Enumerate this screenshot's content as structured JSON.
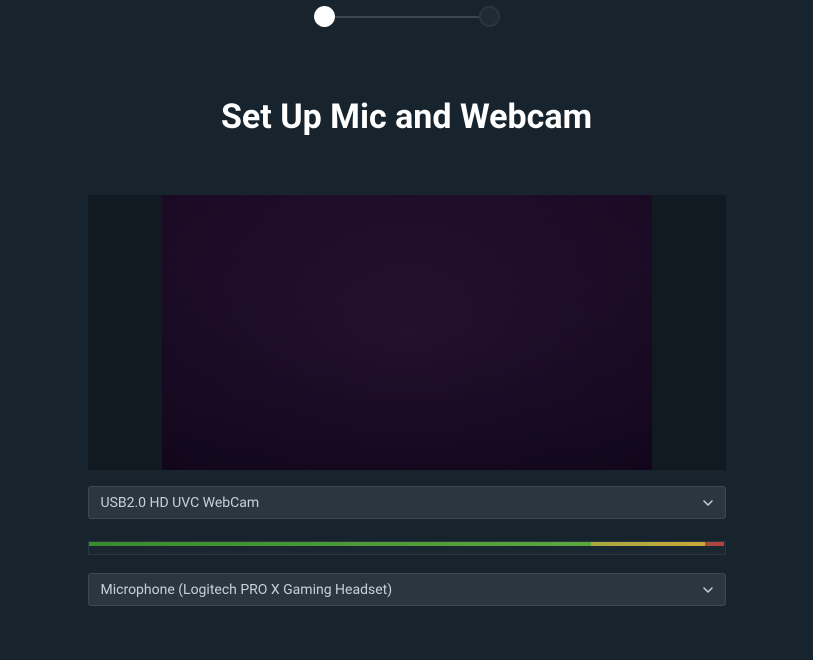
{
  "stepper": {
    "current_step": 1,
    "total_steps": 2
  },
  "title": "Set Up Mic and Webcam",
  "webcam": {
    "selected": "USB2.0 HD UVC WebCam"
  },
  "microphone": {
    "selected": "Microphone (Logitech PRO X Gaming Headset)"
  },
  "meter": {
    "green_percent": 79,
    "yellow_percent": 18,
    "red_percent": 3
  }
}
